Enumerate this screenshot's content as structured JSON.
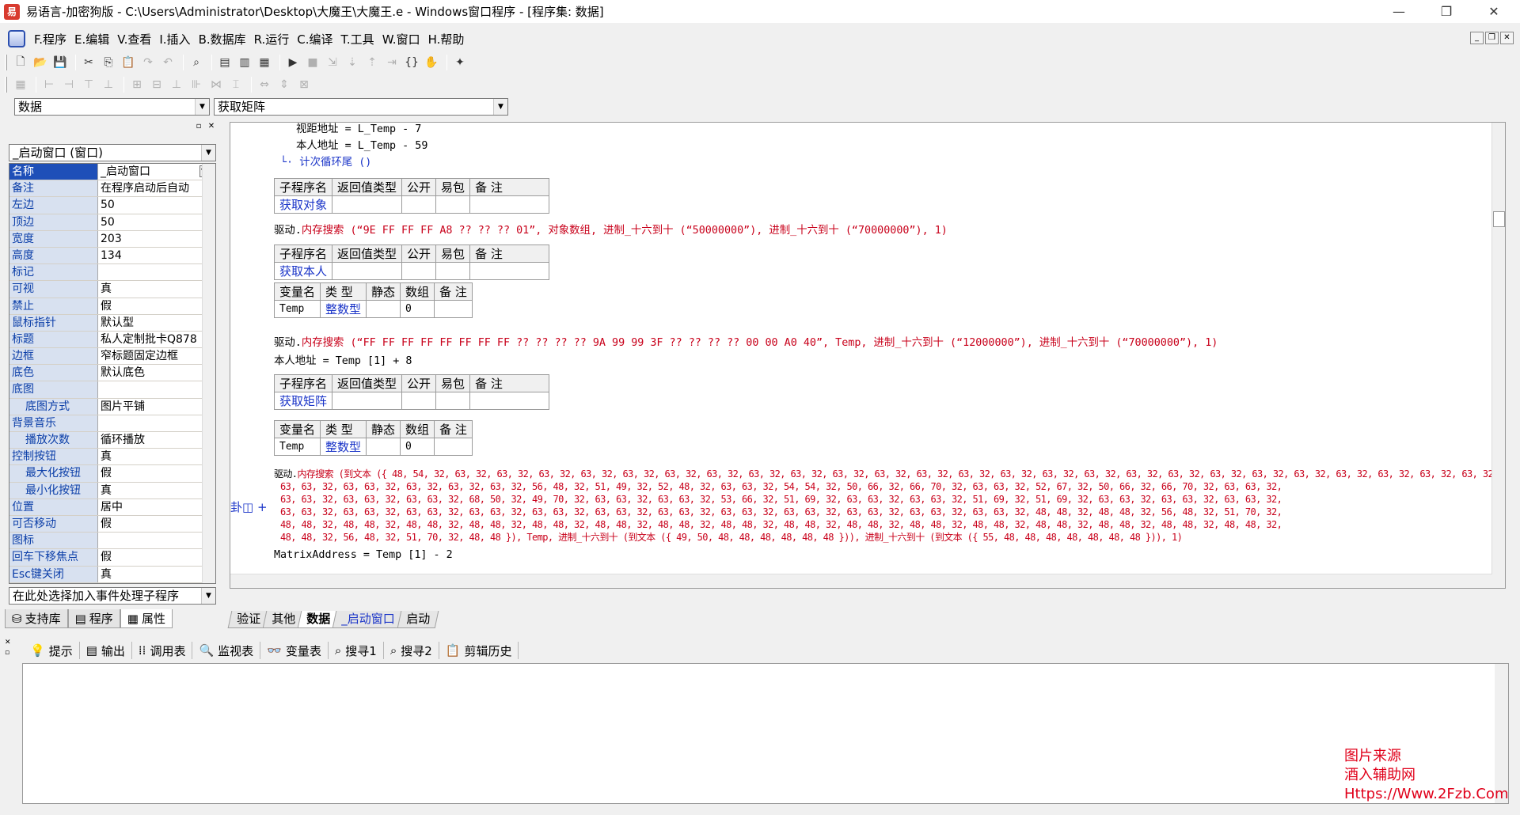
{
  "window": {
    "title": "易语言-加密狗版 - C:\\Users\\Administrator\\Desktop\\大魔王\\大魔王.e - Windows窗口程序 - [程序集: 数据]",
    "app_icon_text": "易",
    "minimize": "—",
    "restore": "❐",
    "close": "✕"
  },
  "menu": {
    "items": [
      "F.程序",
      "E.编辑",
      "V.查看",
      "I.插入",
      "B.数据库",
      "R.运行",
      "C.编译",
      "T.工具",
      "W.窗口",
      "H.帮助"
    ],
    "mdi": [
      "_",
      "❐",
      "✕"
    ]
  },
  "toolbar1": {
    "icons": [
      "new-file-icon",
      "open-file-icon",
      "save-icon",
      "cut-icon",
      "copy-icon",
      "paste-icon",
      "redo-icon",
      "undo-icon",
      "find-icon",
      "layout1-icon",
      "layout2-icon",
      "layout3-icon",
      "run-icon",
      "stop-icon",
      "step1-icon",
      "step2-icon",
      "step3-icon",
      "step4-icon",
      "step5-icon",
      "hand-icon",
      "wizard-icon"
    ]
  },
  "combos": {
    "module": "数据",
    "subroutine": "获取矩阵"
  },
  "left_panel": {
    "ctrls": [
      "▫",
      "✕"
    ],
    "object_combo": "_启动窗口 (窗口)",
    "properties": [
      {
        "name": "名称",
        "value": "_启动窗口",
        "sel": true
      },
      {
        "name": "备注",
        "value": "在程序启动后自动"
      },
      {
        "name": "左边",
        "value": "50"
      },
      {
        "name": "顶边",
        "value": "50"
      },
      {
        "name": "宽度",
        "value": "203"
      },
      {
        "name": "高度",
        "value": "134"
      },
      {
        "name": "标记",
        "value": ""
      },
      {
        "name": "可视",
        "value": "真"
      },
      {
        "name": "禁止",
        "value": "假"
      },
      {
        "name": "鼠标指针",
        "value": "默认型"
      },
      {
        "name": "标题",
        "value": "私人定制批卡Q878"
      },
      {
        "name": "边框",
        "value": "窄标题固定边框"
      },
      {
        "name": "底色",
        "value": "默认底色"
      },
      {
        "name": "底图",
        "value": ""
      },
      {
        "name": "底图方式",
        "value": "图片平铺",
        "sub": true
      },
      {
        "name": "背景音乐",
        "value": ""
      },
      {
        "name": "播放次数",
        "value": "循环播放",
        "sub": true
      },
      {
        "name": "控制按钮",
        "value": "真"
      },
      {
        "name": "最大化按钮",
        "value": "假",
        "sub": true
      },
      {
        "name": "最小化按钮",
        "value": "真",
        "sub": true
      },
      {
        "name": "位置",
        "value": "居中"
      },
      {
        "name": "可否移动",
        "value": "假"
      },
      {
        "name": "图标",
        "value": ""
      },
      {
        "name": "回车下移焦点",
        "value": "假"
      },
      {
        "name": "Esc键关闭",
        "value": "真"
      }
    ],
    "event_combo": "在此处选择加入事件处理子程序",
    "tabs": [
      "支持库",
      "程序",
      "属性"
    ]
  },
  "code": {
    "header_cols": [
      "子程序名",
      "返回值类型",
      "公开",
      "易包",
      "备 注"
    ],
    "var_cols": [
      "变量名",
      "类 型",
      "静态",
      "数组",
      "备 注"
    ],
    "line1": "视距地址 = L_Temp - 7",
    "line2": "本人地址 = L_Temp - 59",
    "line3": "计次循环尾 ()",
    "sub1": "获取对象",
    "call1_prefix": "驱动.",
    "call1": "内存搜索 (“9E FF FF FF A8 ?? ?? ?? 01”, 对象数组, 进制_十六到十 (“50000000”), 进制_十六到十 (“70000000”), 1)",
    "sub2": "获取本人",
    "var1_name": "Temp",
    "var1_type": "整数型",
    "var1_arr": "0",
    "call2": "内存搜索 (“FF FF FF FF FF FF FF FF ?? ?? ?? ?? 9A 99 99 3F ?? ?? ?? ?? 00 00 A0 40”, Temp, 进制_十六到十 (“12000000”), 进制_十六到十 (“70000000”), 1)",
    "line_self": "本人地址 = Temp [1] + 8",
    "sub3": "获取矩阵",
    "var2_name": "Temp",
    "var2_type": "整数型",
    "var2_arr": "0",
    "call3_l1": "内存搜索 (到文本 ({ 48, 54, 32, 63, 32, 63, 32, 63, 32, 63, 32, 63, 32, 63, 32, 63, 32, 63, 32, 63, 32, 63, 32, 63, 32, 63, 32, 63, 32, 63, 32, 63, 32, 63, 32, 63, 32, 63, 32, 63, 32, 63, 32, 63, 32, 63, 32, 63, 32, 63, 32, 63, 32, 63, 32, 63, 32,",
    "call3_l2": "63, 63, 32, 63, 63, 32, 63, 32, 63, 32, 63, 32, 56, 48, 32, 51, 49, 32, 52, 48, 32, 63, 63, 32, 54, 54, 32, 50, 66, 32, 66, 70, 32, 63, 63, 32, 52, 67, 32, 50, 66, 32, 66, 70, 32, 63, 63, 32,",
    "call3_l3": "63, 63, 32, 63, 63, 32, 63, 63, 32, 68, 50, 32, 49, 70, 32, 63, 63, 32, 63, 63, 32, 53, 66, 32, 51, 69, 32, 63, 63, 32, 63, 63, 32, 51, 69, 32, 51, 69, 32, 63, 63, 32, 63, 63, 32, 63, 63, 32,",
    "call3_l4": "63, 63, 32, 63, 63, 32, 63, 63, 32, 63, 63, 32, 63, 63, 32, 63, 63, 32, 63, 63, 32, 63, 63, 32, 63, 63, 32, 63, 63, 32, 63, 63, 32, 63, 63, 32, 48, 48, 32, 48, 48, 32, 56, 48, 32, 51, 70, 32,",
    "call3_l5": "48, 48, 32, 48, 48, 32, 48, 48, 32, 48, 48, 32, 48, 48, 32, 48, 48, 32, 48, 48, 32, 48, 48, 32, 48, 48, 32, 48, 48, 32, 48, 48, 32, 48, 48, 32, 48, 48, 32, 48, 48, 32, 48, 48, 32, 48, 48, 32,",
    "call3_l6": "48, 48, 32, 56, 48, 32, 51, 70, 32, 48, 48 }), Temp, 进制_十六到十 (到文本 ({ 49, 50, 48, 48, 48, 48, 48, 48 })), 进制_十六到十 (到文本 ({ 55, 48, 48, 48, 48, 48, 48, 48 })), 1)",
    "line_matrix": "MatrixAddress = Temp [1] - 2",
    "gutter": "卦◫ +"
  },
  "code_tabs": [
    "验证",
    "其他",
    "数据",
    "_启动窗口",
    "启动"
  ],
  "output": {
    "buttons": [
      "提示",
      "输出",
      "调用表",
      "监视表",
      "变量表",
      "搜寻1",
      "搜寻2",
      "剪辑历史"
    ]
  },
  "watermark": {
    "line1": "图片来源",
    "line2": "酒入辅助网",
    "line3": "Https://Www.2Fzb.Com"
  }
}
